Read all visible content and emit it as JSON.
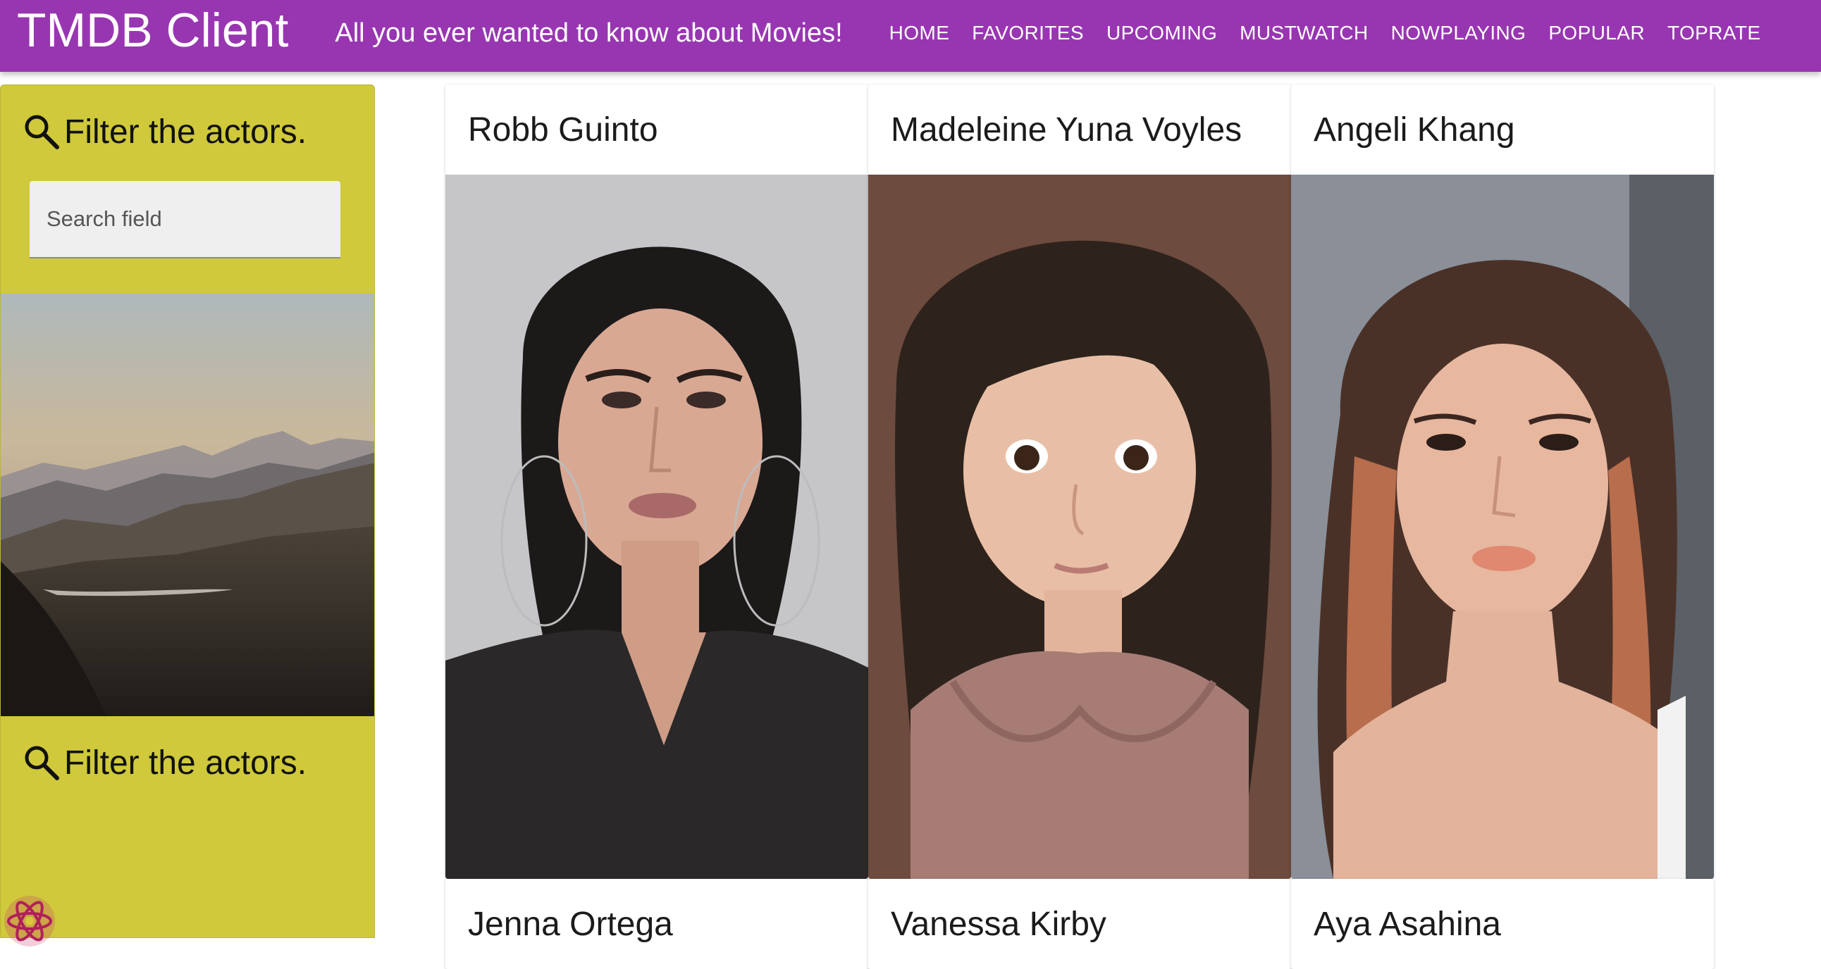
{
  "header": {
    "title": "TMDB Client",
    "subtitle": "All you ever wanted to know about Movies!",
    "nav": [
      "HOME",
      "FAVORITES",
      "UPCOMING",
      "MUSTWATCH",
      "NOWPLAYING",
      "POPULAR",
      "TOPRATE"
    ]
  },
  "sidebar": {
    "filter_label": "Filter the actors.",
    "search_placeholder": "Search field",
    "filter_label_2": "Filter the actors."
  },
  "actors": [
    {
      "name": "Robb Guinto"
    },
    {
      "name": "Madeleine Yuna Voyles"
    },
    {
      "name": "Angeli Khang"
    },
    {
      "name": "Jenna Ortega"
    },
    {
      "name": "Vanessa Kirby"
    },
    {
      "name": "Aya Asahina"
    }
  ],
  "colors": {
    "appbar": "#9836b1",
    "sidebar": "#cfc93b"
  }
}
